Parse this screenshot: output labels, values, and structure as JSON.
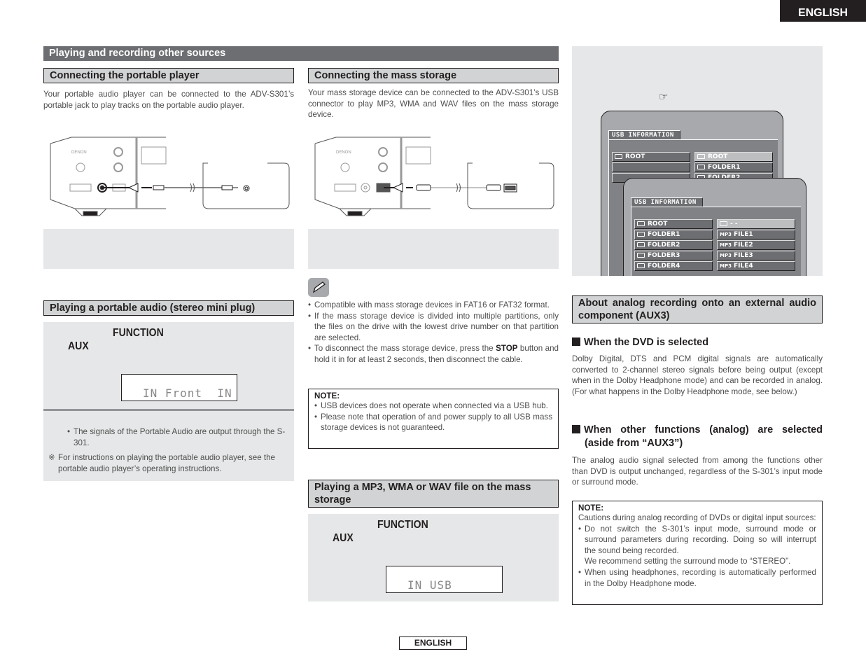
{
  "header": {
    "language_tab": "ENGLISH"
  },
  "section": {
    "title": "Playing and recording other sources"
  },
  "portable": {
    "heading": "Connecting the portable player",
    "text": "Your portable audio player can be connected to the ADV-S301’s portable jack to play tracks on the portable audio player.",
    "figure": {
      "brand_label": "DENON"
    }
  },
  "mass_storage": {
    "heading": "Connecting the mass storage",
    "text": "Your mass storage device can be connected to the ADV-S301’s USB connector to play MP3, WMA and WAV files on the mass storage device.",
    "figure": {
      "brand_label": "DENON"
    }
  },
  "play_portable": {
    "heading": "Playing a portable audio (stereo mini plug)",
    "function_label": "FUNCTION",
    "aux_label": "AUX",
    "display_text": "IN Front  IN",
    "bullet": "The signals of the Portable Audio are output through the S-301.",
    "ref_mark": "※",
    "ref_note": "For instructions on playing the portable audio player, see the portable audio player’s operating instructions."
  },
  "memo": {
    "icon": "pencil-icon",
    "bullets": [
      "Compatible with mass storage devices in FAT16 or FAT32 format.",
      "If the mass storage device is divided into multiple partitions, only the files on the drive with the lowest drive number on that partition are selected."
    ],
    "stop_bullet_pre": "To disconnect the mass storage device, press the ",
    "stop_bullet_key": "STOP",
    "stop_bullet_post": " button and hold it in for at least 2 seconds, then disconnect the cable."
  },
  "usb_note": {
    "title": "NOTE:",
    "bullets": [
      "USB devices does not operate when connected via a USB hub.",
      "Please note that operation of and power supply to all USB mass storage devices is not guaranteed."
    ]
  },
  "play_usb": {
    "heading": "Playing a MP3, WMA or WAV file on the mass storage",
    "function_label": "FUNCTION",
    "aux_label": "AUX",
    "display_text": "IN USB"
  },
  "osd": {
    "ref_icon": "pointing-hand-icon",
    "back": {
      "title": "USB INFORMATION",
      "left": [
        "ROOT",
        "",
        ""
      ],
      "right": [
        "ROOT",
        "FOLDER1",
        "FOLDER2"
      ]
    },
    "front": {
      "title": "USB INFORMATION",
      "left": [
        "ROOT",
        "FOLDER1",
        "FOLDER2",
        "FOLDER3",
        "FOLDER4"
      ],
      "right_first": "- -",
      "file_prefix": "MP3",
      "files": [
        "FILE1",
        "FILE2",
        "FILE3",
        "FILE4"
      ]
    }
  },
  "analog": {
    "heading": "About analog recording onto an external audio component (AUX3)",
    "dvd_heading": "When the DVD is selected",
    "dvd_text": "Dolby Digital, DTS and PCM digital signals are automatically converted to 2-channel stereo signals before being output (except when in the Dolby Headphone mode) and can be recorded in analog. (For what happens in the Dolby Headphone mode, see below.)",
    "other_heading": "When other functions (analog) are selected (aside from “AUX3”)",
    "other_text": "The analog audio signal selected from among the functions other than DVD is output unchanged, regardless of the S-301’s input mode or surround mode.",
    "note": {
      "title": "NOTE:",
      "intro": "Cautions during analog recording of DVDs or digital input sources:",
      "bullet1": "Do not switch the S-301’s input mode, surround mode or surround parameters during recording. Doing so will interrupt the sound being recorded.",
      "bullet1_extra": "We recommend setting the surround mode to “STEREO”.",
      "bullet2": "When using headphones, recording is automatically performed in the Dolby Headphone mode."
    }
  },
  "footer": {
    "language_label": "ENGLISH"
  }
}
